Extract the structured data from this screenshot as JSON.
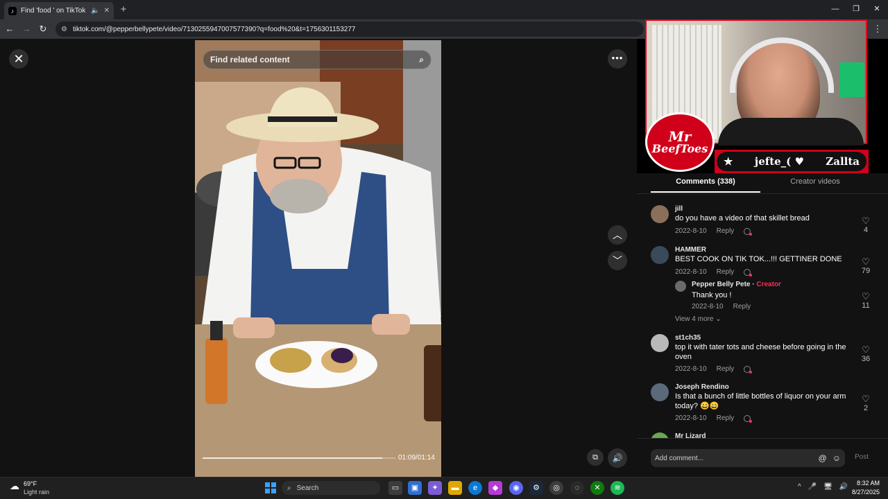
{
  "browser": {
    "tab_title": "Find 'food ' on TikTok | TikTok",
    "tab_audio_icon": "speaker-icon",
    "new_tab_label": "+",
    "url": "tiktok.com/@pepperbellypete/video/7130255947007577390?q=food%20&t=1756301153277",
    "window_buttons": [
      "—",
      "❐",
      "✕"
    ]
  },
  "video": {
    "search_placeholder": "Find related content",
    "timecode": "01:09/01:14",
    "progress_fraction": 0.93
  },
  "panel": {
    "tabs": {
      "comments": "Comments (338)",
      "creator": "Creator videos"
    },
    "view_more": "View 4 more",
    "comments": [
      {
        "user": "jill",
        "text": "do you have a video of that skillet bread",
        "date": "2022-8-10",
        "reply": "Reply",
        "likes": "4",
        "avatar_color": "#8a6f5a"
      },
      {
        "user": "HAMMER",
        "text": "BEST COOK ON TIK TOK...!!! GETTINER DONE",
        "date": "2022-8-10",
        "reply": "Reply",
        "likes": "79",
        "avatar_color": "#3b4a5a"
      },
      {
        "user": "Pepper Belly Pete",
        "badge": "Creator",
        "sep": " · ",
        "text": "Thank you !",
        "date": "2022-8-10",
        "reply": "Reply",
        "likes": "11",
        "avatar_color": "#6a6a6a"
      },
      {
        "user": "st1ch35",
        "text": "top it with tater tots and cheese before going in the oven",
        "date": "2022-8-10",
        "reply": "Reply",
        "likes": "36",
        "avatar_color": "#b9b9b9"
      },
      {
        "user": "Joseph Rendino",
        "text": "Is that a bunch of little bottles of liquor on your arm today? 😄😄",
        "date": "2022-8-10",
        "reply": "Reply",
        "likes": "2",
        "avatar_color": "#5a6a7a"
      },
      {
        "user": "Mr Lizard",
        "text": "",
        "date": "",
        "reply": "",
        "likes": "",
        "avatar_color": "#6aa84f"
      }
    ],
    "add_comment_placeholder": "Add comment...",
    "post_label": "Post"
  },
  "overlay": {
    "logo_line1": "Mr",
    "logo_line2": "BeefToes",
    "nameplate_left": "★",
    "nameplate_name": "jefte_( ♥",
    "nameplate_right": "Zallta"
  },
  "taskbar": {
    "weather_temp": "69°F",
    "weather_cond": "Light rain",
    "search_label": "Search",
    "time": "8:32 AM",
    "date": "8/27/2025",
    "tray_icons": [
      "^",
      "🎤",
      "🖥",
      "🔊"
    ]
  },
  "colors": {
    "accent": "#fe2c55",
    "overlay_red": "#d0001a",
    "background": "#121212"
  }
}
